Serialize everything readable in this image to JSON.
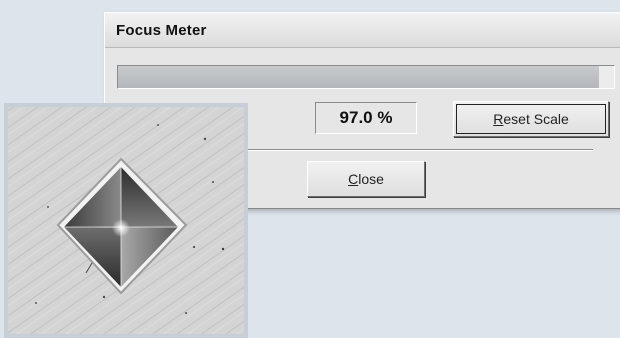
{
  "dialog": {
    "title": "Focus Meter",
    "meter": {
      "level_percent": 97.0,
      "fill_color": "#b4b8bc"
    },
    "value_display": "97.0 %",
    "reset_button": {
      "label_accesskey": "R",
      "label_rest": "eset Scale"
    },
    "close_button": {
      "label_accesskey": "C",
      "label_rest": "lose"
    }
  },
  "specimen_image": {
    "subject": "diamond-indentation-on-metal-surface"
  },
  "colors": {
    "background": "#dde4ec",
    "dialog_face": "#e6e6e6",
    "image_frame": "#c6cfd8"
  }
}
